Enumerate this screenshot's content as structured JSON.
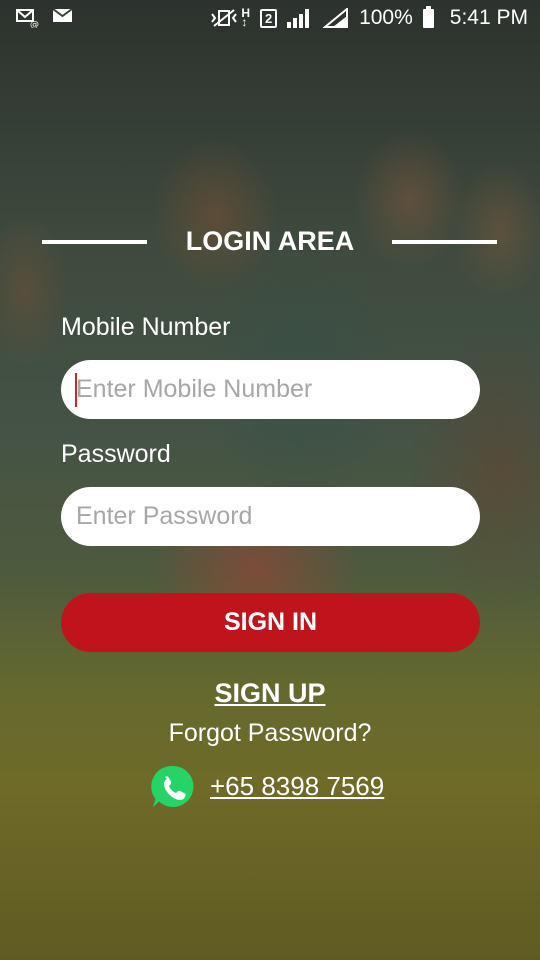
{
  "status_bar": {
    "battery": "100%",
    "time": "5:41 PM",
    "sim_slot": "2"
  },
  "login": {
    "title": "LOGIN AREA",
    "mobile_label": "Mobile Number",
    "mobile_placeholder": "Enter Mobile Number",
    "mobile_value": "",
    "password_label": "Password",
    "password_placeholder": "Enter Password",
    "password_value": "",
    "signin_label": "SIGN IN",
    "signup_label": "SIGN UP",
    "forgot_label": "Forgot Password?",
    "phone_number": "+65 8398 7569"
  },
  "colors": {
    "primary_button": "#c0141d",
    "whatsapp_green": "#25d366"
  },
  "icons": [
    "mail-notification-icon",
    "mail-icon",
    "vibrate-icon",
    "h-plus-icon",
    "sim-2-icon",
    "signal-icon",
    "battery-icon",
    "whatsapp-icon"
  ]
}
